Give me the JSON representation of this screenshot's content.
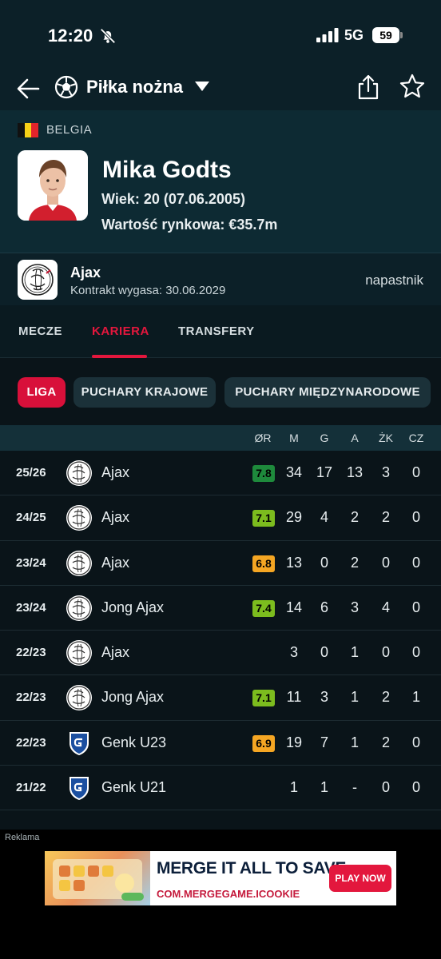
{
  "status_bar": {
    "time": "12:20",
    "network": "5G",
    "battery": "59"
  },
  "nav": {
    "sport_title": "Piłka nożna"
  },
  "player": {
    "country": "BELGIA",
    "name": "Mika Godts",
    "age": "Wiek: 20 (07.06.2005)",
    "market_value": "Wartość rynkowa: €35.7m"
  },
  "club": {
    "name": "Ajax",
    "contract": "Kontrakt wygasa: 30.06.2029",
    "position": "napastnik"
  },
  "tabs": [
    {
      "label": "MECZE"
    },
    {
      "label": "KARIERA"
    },
    {
      "label": "TRANSFERY"
    }
  ],
  "filters": [
    {
      "label": "LIGA"
    },
    {
      "label": "PUCHARY KRAJOWE"
    },
    {
      "label": "PUCHARY MIĘDZYNARODOWE"
    }
  ],
  "table": {
    "headers": [
      "ØR",
      "M",
      "G",
      "A",
      "ŻK",
      "CZ"
    ],
    "rows": [
      {
        "season": "25/26",
        "team": "Ajax",
        "club": "ajax",
        "rating": "7.8",
        "rating_color": "#1e8a3c",
        "m": "34",
        "g": "17",
        "a": "13",
        "yc": "3",
        "rc": "0"
      },
      {
        "season": "24/25",
        "team": "Ajax",
        "club": "ajax",
        "rating": "7.1",
        "rating_color": "#7cbc1e",
        "m": "29",
        "g": "4",
        "a": "2",
        "yc": "2",
        "rc": "0"
      },
      {
        "season": "23/24",
        "team": "Ajax",
        "club": "ajax",
        "rating": "6.8",
        "rating_color": "#f5a623",
        "m": "13",
        "g": "0",
        "a": "2",
        "yc": "0",
        "rc": "0"
      },
      {
        "season": "23/24",
        "team": "Jong Ajax",
        "club": "ajax",
        "rating": "7.4",
        "rating_color": "#7cbc1e",
        "m": "14",
        "g": "6",
        "a": "3",
        "yc": "4",
        "rc": "0"
      },
      {
        "season": "22/23",
        "team": "Ajax",
        "club": "ajax",
        "rating": "",
        "rating_color": "",
        "m": "3",
        "g": "0",
        "a": "1",
        "yc": "0",
        "rc": "0"
      },
      {
        "season": "22/23",
        "team": "Jong Ajax",
        "club": "ajax",
        "rating": "7.1",
        "rating_color": "#7cbc1e",
        "m": "11",
        "g": "3",
        "a": "1",
        "yc": "2",
        "rc": "1"
      },
      {
        "season": "22/23",
        "team": "Genk U23",
        "club": "genk",
        "rating": "6.9",
        "rating_color": "#f5a623",
        "m": "19",
        "g": "7",
        "a": "1",
        "yc": "2",
        "rc": "0"
      },
      {
        "season": "21/22",
        "team": "Genk U21",
        "club": "genk",
        "rating": "",
        "rating_color": "",
        "m": "1",
        "g": "1",
        "a": "-",
        "yc": "0",
        "rc": "0"
      }
    ]
  },
  "ad": {
    "label": "Reklama",
    "headline": "MERGE IT ALL TO SAVE",
    "url": "COM.MERGEGAME.ICOOKIE",
    "cta": "PLAY NOW"
  }
}
